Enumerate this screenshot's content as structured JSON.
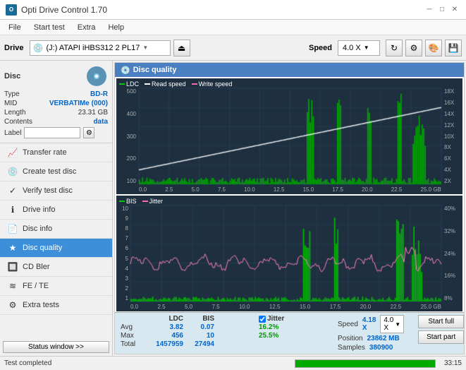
{
  "titleBar": {
    "title": "Opti Drive Control 1.70",
    "minBtn": "─",
    "maxBtn": "□",
    "closeBtn": "✕"
  },
  "menuBar": {
    "items": [
      "File",
      "Start test",
      "Extra",
      "Help"
    ]
  },
  "toolbar": {
    "driveLabel": "Drive",
    "driveValue": "(J:) ATAPI iHBS312  2 PL17",
    "speedLabel": "Speed",
    "speedValue": "4.0 X"
  },
  "disc": {
    "type": "BD-R",
    "mid": "VERBATIMe (000)",
    "length": "23.31 GB",
    "contents": "data",
    "labelPlaceholder": ""
  },
  "navItems": [
    {
      "id": "transfer-rate",
      "label": "Transfer rate",
      "icon": "📈"
    },
    {
      "id": "create-test-disc",
      "label": "Create test disc",
      "icon": "💿"
    },
    {
      "id": "verify-test-disc",
      "label": "Verify test disc",
      "icon": "✓"
    },
    {
      "id": "drive-info",
      "label": "Drive info",
      "icon": "ℹ"
    },
    {
      "id": "disc-info",
      "label": "Disc info",
      "icon": "📄"
    },
    {
      "id": "disc-quality",
      "label": "Disc quality",
      "icon": "★",
      "active": true
    },
    {
      "id": "cd-bler",
      "label": "CD Bler",
      "icon": "🔲"
    },
    {
      "id": "fe-te",
      "label": "FE / TE",
      "icon": "≋"
    },
    {
      "id": "extra-tests",
      "label": "Extra tests",
      "icon": "⚙"
    }
  ],
  "statusWindowBtn": "Status window >>",
  "discQuality": {
    "title": "Disc quality",
    "legend1": [
      "LDC",
      "Read speed",
      "Write speed"
    ],
    "legend2": [
      "BIS",
      "Jitter"
    ],
    "stats": {
      "columns": [
        "LDC",
        "BIS",
        "Jitter"
      ],
      "rows": [
        {
          "label": "Avg",
          "ldc": "3.82",
          "bis": "0.07",
          "jitter": "16.2%"
        },
        {
          "label": "Max",
          "ldc": "456",
          "bis": "10",
          "jitter": "25.5%"
        },
        {
          "label": "Total",
          "ldc": "1457959",
          "bis": "27494",
          "jitter": ""
        }
      ],
      "speed": "4.18 X",
      "speedLabel": "Speed",
      "speedSelect": "4.0 X",
      "position": "23862 MB",
      "positionLabel": "Position",
      "samples": "380900",
      "samplesLabel": "Samples",
      "jitterChecked": true,
      "jitterLabel": "Jitter"
    },
    "startFull": "Start full",
    "startPart": "Start part"
  },
  "statusBar": {
    "text": "Test completed",
    "progress": 100,
    "time": "33:15"
  }
}
